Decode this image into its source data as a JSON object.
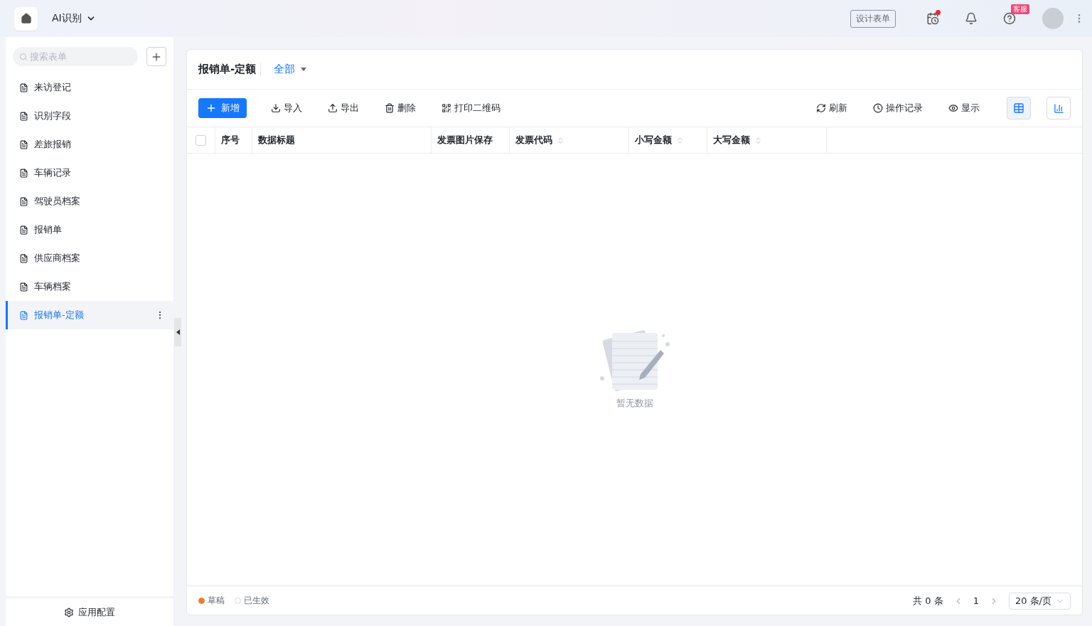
{
  "topbar": {
    "app_name": "AI识别",
    "design_button": "设计表单",
    "help_badge": "客服",
    "task_notification": true
  },
  "sidebar": {
    "search_placeholder": "搜索表单",
    "items": [
      {
        "label": "来访登记",
        "selected": false
      },
      {
        "label": "识别字段",
        "selected": false
      },
      {
        "label": "差旅报销",
        "selected": false
      },
      {
        "label": "车辆记录",
        "selected": false
      },
      {
        "label": "驾驶员档案",
        "selected": false
      },
      {
        "label": "报销单",
        "selected": false
      },
      {
        "label": "供应商档案",
        "selected": false
      },
      {
        "label": "车辆档案",
        "selected": false
      },
      {
        "label": "报销单-定额",
        "selected": true
      }
    ],
    "footer": "应用配置"
  },
  "main": {
    "title": "报销单-定额",
    "filter": "全部",
    "actions": [
      {
        "kind": "primary",
        "label": "新增"
      },
      {
        "kind": "import",
        "label": "导入"
      },
      {
        "kind": "export",
        "label": "导出"
      },
      {
        "kind": "delete",
        "label": "删除"
      },
      {
        "kind": "qrcode",
        "label": "打印二维码"
      }
    ],
    "right_actions": [
      {
        "kind": "refresh",
        "label": "刷新"
      },
      {
        "kind": "history",
        "label": "操作记录"
      },
      {
        "kind": "display",
        "label": "显示"
      }
    ],
    "views": [
      {
        "kind": "table",
        "selected": true
      },
      {
        "kind": "chart",
        "selected": false
      }
    ],
    "table": {
      "select_all_checked": false,
      "columns": [
        {
          "label": "序号",
          "sortable": false
        },
        {
          "label": "数据标题",
          "sortable": false
        },
        {
          "label": "发票图片保存",
          "sortable": false
        },
        {
          "label": "发票代码",
          "sortable": true
        },
        {
          "label": "小写金额",
          "sortable": true
        },
        {
          "label": "大写金额",
          "sortable": true
        }
      ],
      "empty_text": "暂无数据"
    },
    "legend": [
      {
        "label": "草稿",
        "kind": "filled",
        "color": "#f07c2e"
      },
      {
        "label": "已生效",
        "kind": "hollow",
        "color": "#d9d9d9"
      }
    ],
    "pagination": {
      "total": "共 0 条",
      "page": "1",
      "page_size": "20 条/页"
    }
  }
}
